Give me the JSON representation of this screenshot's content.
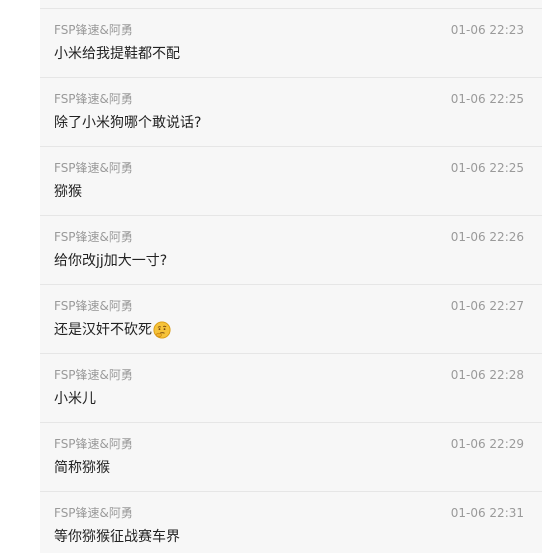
{
  "comments": [
    {
      "user": "FSP锋速&阿勇",
      "time": "01-06 22:23",
      "text": "小米给我提鞋都不配",
      "emoji": ""
    },
    {
      "user": "FSP锋速&阿勇",
      "time": "01-06 22:25",
      "text": "除了小米狗哪个敢说话?",
      "emoji": ""
    },
    {
      "user": "FSP锋速&阿勇",
      "time": "01-06 22:25",
      "text": "猕猴",
      "emoji": ""
    },
    {
      "user": "FSP锋速&阿勇",
      "time": "01-06 22:26",
      "text": "给你改jj加大一寸?",
      "emoji": ""
    },
    {
      "user": "FSP锋速&阿勇",
      "time": "01-06 22:27",
      "text": "还是汉奸不砍死",
      "emoji": "thinking-face-icon"
    },
    {
      "user": "FSP锋速&阿勇",
      "time": "01-06 22:28",
      "text": "小米儿",
      "emoji": ""
    },
    {
      "user": "FSP锋速&阿勇",
      "time": "01-06 22:29",
      "text": "简称猕猴",
      "emoji": ""
    },
    {
      "user": "FSP锋速&阿勇",
      "time": "01-06 22:31",
      "text": "等你猕猴征战赛车界",
      "emoji": ""
    }
  ],
  "colors": {
    "panel_background": "#f7f7f7",
    "meta_text": "#9a9a9a",
    "content_text": "#222222",
    "divider": "#e6e6e6"
  }
}
